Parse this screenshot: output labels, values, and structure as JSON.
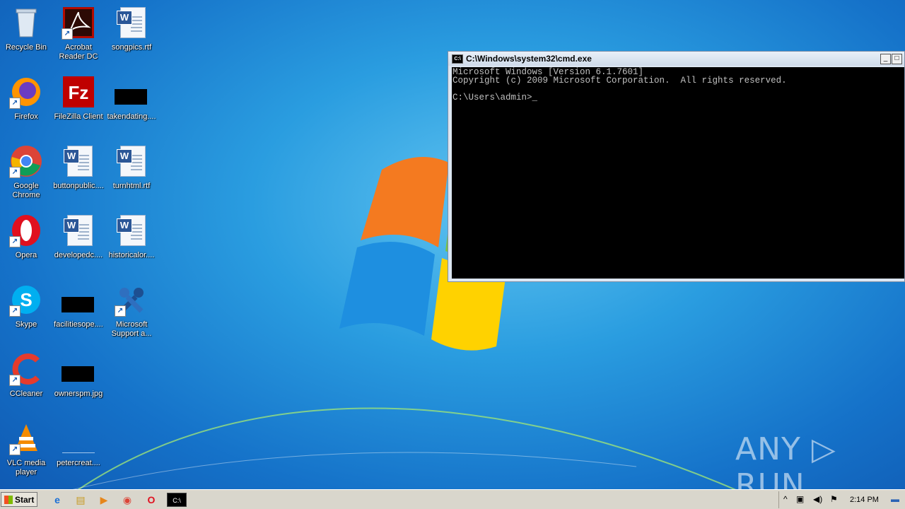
{
  "desktop": {
    "icons": [
      {
        "label": "Recycle Bin",
        "icon": "recycle-bin-icon"
      },
      {
        "label": "Acrobat\nReader DC",
        "icon": "acrobat-icon"
      },
      {
        "label": "songpics.rtf",
        "icon": "word-doc-icon"
      },
      {
        "label": "Firefox",
        "icon": "firefox-icon"
      },
      {
        "label": "FileZilla Client",
        "icon": "filezilla-icon"
      },
      {
        "label": "takendating....",
        "icon": "redacted-icon"
      },
      {
        "label": "Google\nChrome",
        "icon": "chrome-icon"
      },
      {
        "label": "buttonpublic....",
        "icon": "word-doc-icon"
      },
      {
        "label": "turnhtml.rtf",
        "icon": "word-doc-icon"
      },
      {
        "label": "Opera",
        "icon": "opera-icon"
      },
      {
        "label": "developedc....",
        "icon": "word-doc-icon"
      },
      {
        "label": "historicalor....",
        "icon": "word-doc-icon"
      },
      {
        "label": "Skype",
        "icon": "skype-icon"
      },
      {
        "label": "facilitiesope....",
        "icon": "redacted-icon"
      },
      {
        "label": "Microsoft\nSupport a...",
        "icon": "tools-icon"
      },
      {
        "label": "CCleaner",
        "icon": "ccleaner-icon"
      },
      {
        "label": "ownerspm.jpg",
        "icon": "redacted-icon"
      },
      {
        "label": "VLC media\nplayer",
        "icon": "vlc-icon"
      },
      {
        "label": "petercreat....",
        "icon": "blank-file-icon"
      }
    ]
  },
  "cmd": {
    "title": "C:\\Windows\\system32\\cmd.exe",
    "icon_text": "C:\\",
    "minimize": "_",
    "maximize": "□",
    "lines": "Microsoft Windows [Version 6.1.7601]\nCopyright (c) 2009 Microsoft Corporation.  All rights reserved.\n\nC:\\Users\\admin>_"
  },
  "watermark": "ANY ▷ RUN",
  "taskbar": {
    "start_label": "Start",
    "pinned": [
      "ie-icon",
      "explorer-icon",
      "media-player-icon",
      "chrome-icon",
      "opera-icon",
      "cmd-icon"
    ],
    "pinned_glyphs": [
      "e",
      "▤",
      "▶",
      "◉",
      "O",
      "C:\\"
    ],
    "tray": {
      "chevron": "^",
      "network": "▣",
      "volume": "◀)",
      "flag": "⚑",
      "time": "2:14 PM",
      "desktop": "▬"
    }
  }
}
